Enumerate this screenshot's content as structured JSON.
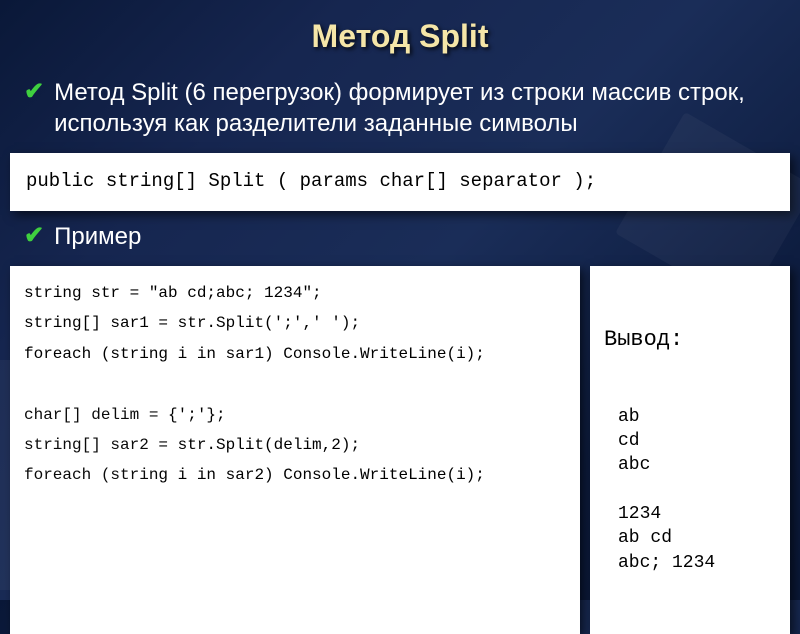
{
  "title": "Метод Split",
  "bullet1": "Метод  Split  (6 перегрузок)  формирует из строки массив строк, используя как разделители заданные символы",
  "signature": "public string[] Split ( params char[] separator );",
  "bullet2": "Пример",
  "example_code": "string str = \"ab cd;abc; 1234\";\nstring[] sar1 = str.Split(';',' ');\nforeach (string i in sar1) Console.WriteLine(i);\n\nchar[] delim = {';'};\nstring[] sar2 = str.Split(delim,2);\nforeach (string i in sar2) Console.WriteLine(i);",
  "output_title": "Вывод:",
  "output_lines": "ab\ncd\nabc\n\n1234\nab cd\nabc; 1234"
}
